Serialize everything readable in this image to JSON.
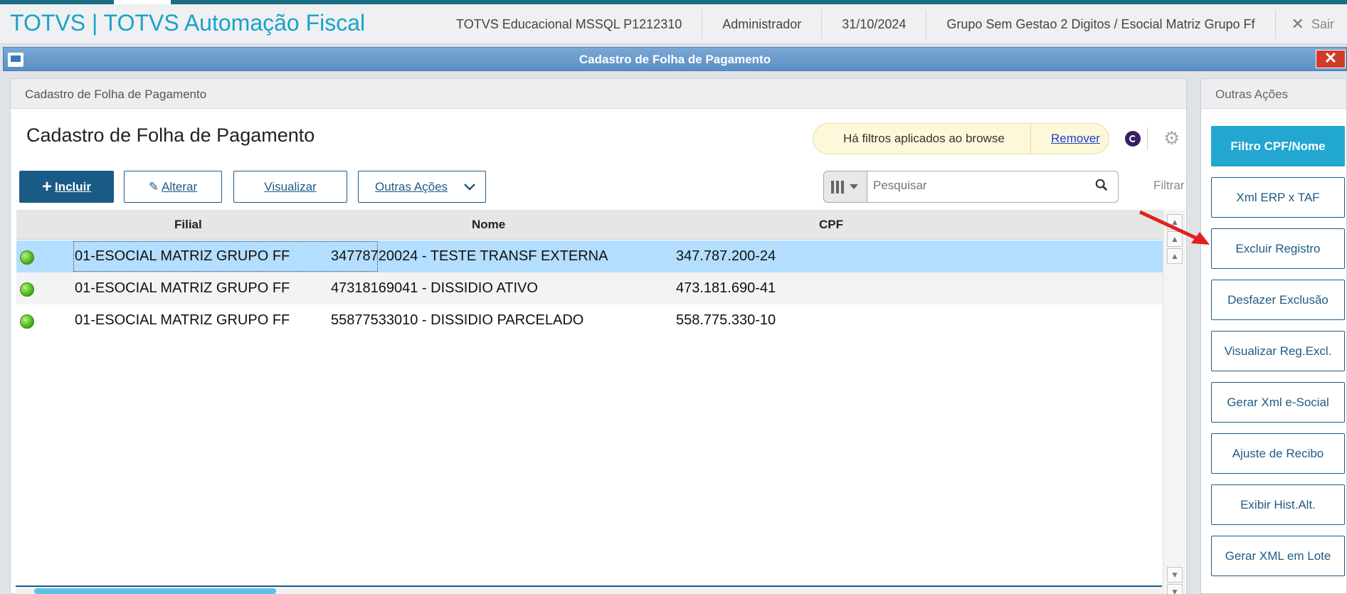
{
  "header": {
    "app_title": "TOTVS | TOTVS Automação Fiscal",
    "environment": "TOTVS Educacional MSSQL P1212310",
    "user": "Administrador",
    "date": "31/10/2024",
    "company": "Grupo Sem Gestao 2 Digitos / Esocial Matriz Grupo Ff",
    "exit_label": "Sair"
  },
  "window": {
    "title": "Cadastro de Folha de Pagamento"
  },
  "browse": {
    "panel_title": "Cadastro de Folha de Pagamento",
    "title": "Cadastro de Folha de Pagamento",
    "filter_msg": "Há filtros aplicados ao browse",
    "remove_label": "Remover",
    "buttons": {
      "incluir": "Incluir",
      "alterar": "Alterar",
      "visualizar": "Visualizar",
      "outras": "Outras Ações"
    },
    "search_placeholder": "Pesquisar",
    "filter_label": "Filtrar",
    "columns": [
      "Filial",
      "Nome",
      "CPF"
    ],
    "rows": [
      {
        "filial": "01-ESOCIAL MATRIZ GRUPO FF",
        "nome": "34778720024 - TESTE TRANSF EXTERNA",
        "cpf": "347.787.200-24",
        "status": "green"
      },
      {
        "filial": "01-ESOCIAL MATRIZ GRUPO FF",
        "nome": "47318169041 - DISSIDIO ATIVO",
        "cpf": "473.181.690-41",
        "status": "green"
      },
      {
        "filial": "01-ESOCIAL MATRIZ GRUPO FF",
        "nome": "55877533010 - DISSIDIO PARCELADO",
        "cpf": "558.775.330-10",
        "status": "green"
      }
    ]
  },
  "side": {
    "title": "Outras Ações",
    "buttons": [
      "Filtro CPF/Nome",
      "Xml ERP x TAF",
      "Excluir Registro",
      "Desfazer Exclusão",
      "Visualizar Reg.Excl.",
      "Gerar Xml e-Social",
      "Ajuste de Recibo",
      "Exibir Hist.Alt.",
      "Gerar XML em Lote"
    ]
  },
  "colors": {
    "accent": "#1aa2c8",
    "primary_button": "#1a5a86",
    "highlight_button": "#22a7d1",
    "selected_row": "#b4deff",
    "annotation_arrow": "#e02020"
  }
}
